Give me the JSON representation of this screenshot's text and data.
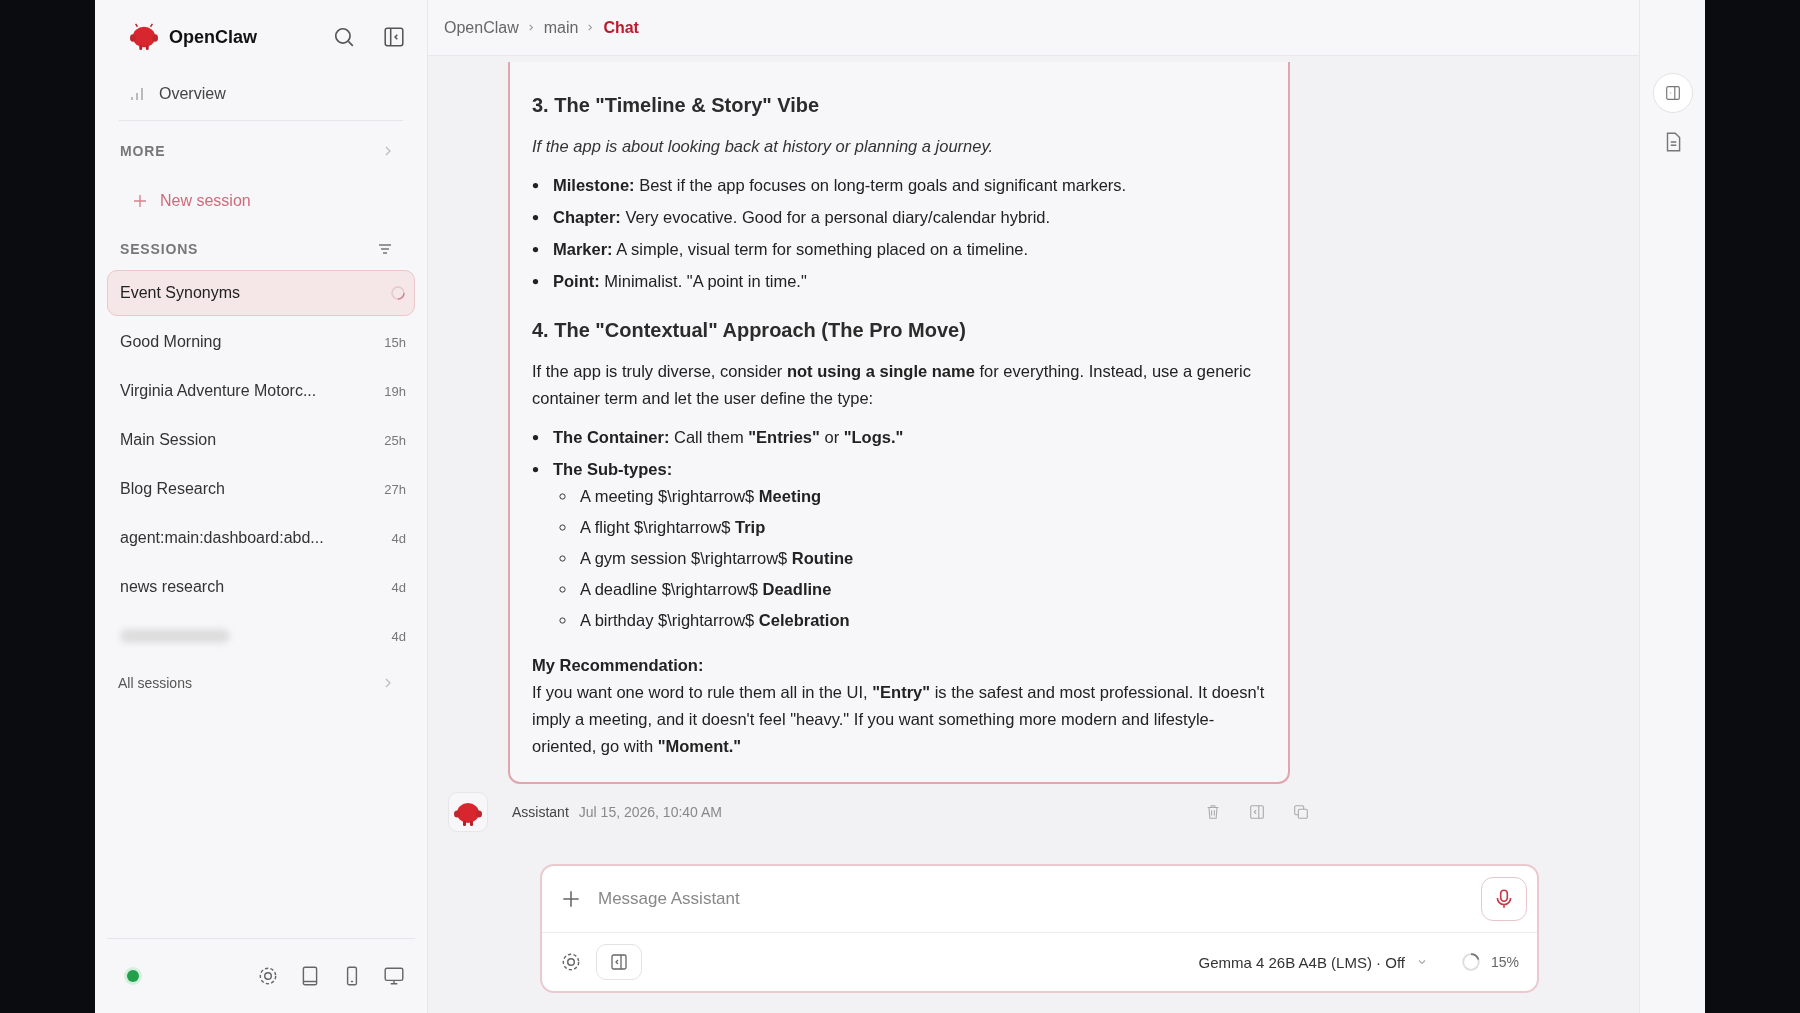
{
  "sidebar": {
    "brand": "OpenClaw",
    "overview": "Overview",
    "more": "MORE",
    "new_session": "New session",
    "sessions_heading": "SESSIONS",
    "sessions": [
      {
        "kind": "normal",
        "name": "Event Synonyms",
        "selected": true,
        "loading": true
      },
      {
        "kind": "normal",
        "name": "Good Morning",
        "time": "15h",
        "selected": false,
        "loading": false
      },
      {
        "kind": "normal",
        "name": "Virginia Adventure Motorc...",
        "time": "19h",
        "selected": false,
        "loading": false
      },
      {
        "kind": "normal",
        "name": "Main Session",
        "time": "25h",
        "selected": false,
        "loading": false
      },
      {
        "kind": "normal",
        "name": "Blog Research",
        "time": "27h",
        "selected": false,
        "loading": false
      },
      {
        "kind": "normal",
        "name": "agent:main:dashboard:abd...",
        "time": "4d",
        "selected": false,
        "loading": false
      },
      {
        "kind": "normal",
        "name": "news research",
        "time": "4d",
        "selected": false,
        "loading": false
      },
      {
        "kind": "redacted",
        "time": "4d",
        "selected": false,
        "loading": false
      }
    ],
    "all_sessions": "All sessions",
    "connected": true
  },
  "breadcrumb": [
    {
      "label": "OpenClaw",
      "selected": false
    },
    {
      "label": "main",
      "selected": false
    },
    {
      "label": "Chat",
      "selected": true
    }
  ],
  "message": {
    "blocks": [
      {
        "kind": "heading",
        "text": "3. The \"Timeline & Story\" Vibe"
      },
      {
        "kind": "note",
        "text": "If the app is about looking back at history or planning a journey."
      },
      {
        "kind": "list",
        "items": [
          {
            "text": "**Milestone:** Best if the app focuses on long-term goals and significant markers."
          },
          {
            "text": "**Chapter:** Very evocative. Good for a personal diary/calendar hybrid."
          },
          {
            "text": "**Marker:** A simple, visual term for something placed on a timeline."
          },
          {
            "text": "**Point:** Minimalist. \"A point in time.\""
          }
        ]
      },
      {
        "kind": "heading",
        "text": "4. The \"Contextual\" Approach (The Pro Move)"
      },
      {
        "kind": "paragraph",
        "text": "If the app is truly diverse, consider **not using a single name** for everything. Instead, use a generic container term and let the user define the type:"
      },
      {
        "kind": "list",
        "items": [
          {
            "text": "**The Container:** Call them **\"Entries\"** or **\"Logs.\"**"
          },
          {
            "text": "**The Sub-types:**",
            "children": [
              {
                "text": "A meeting $\\rightarrow$ **Meeting**"
              },
              {
                "text": "A flight $\\rightarrow$ **Trip**"
              },
              {
                "text": "A gym session $\\rightarrow$ **Routine**"
              },
              {
                "text": "A deadline $\\rightarrow$ **Deadline**"
              },
              {
                "text": "A birthday $\\rightarrow$ **Celebration**"
              }
            ]
          }
        ]
      },
      {
        "kind": "label",
        "text": "My Recommendation:"
      },
      {
        "kind": "paragraph",
        "text": "If you want one word to rule them all in the UI, **\"Entry\"** is the safest and most professional. It doesn't imply a meeting, and it doesn't feel \"heavy.\" If you want something more modern and lifestyle-oriented, go with **\"Moment.\"**"
      }
    ],
    "author": "Assistant",
    "timestamp": "Jul 15, 2026, 10:40 AM"
  },
  "composer": {
    "placeholder": "Message Assistant",
    "model": "Gemma 4 26B A4B (LMS) · Off",
    "context": {
      "reading": "15%"
    }
  }
}
